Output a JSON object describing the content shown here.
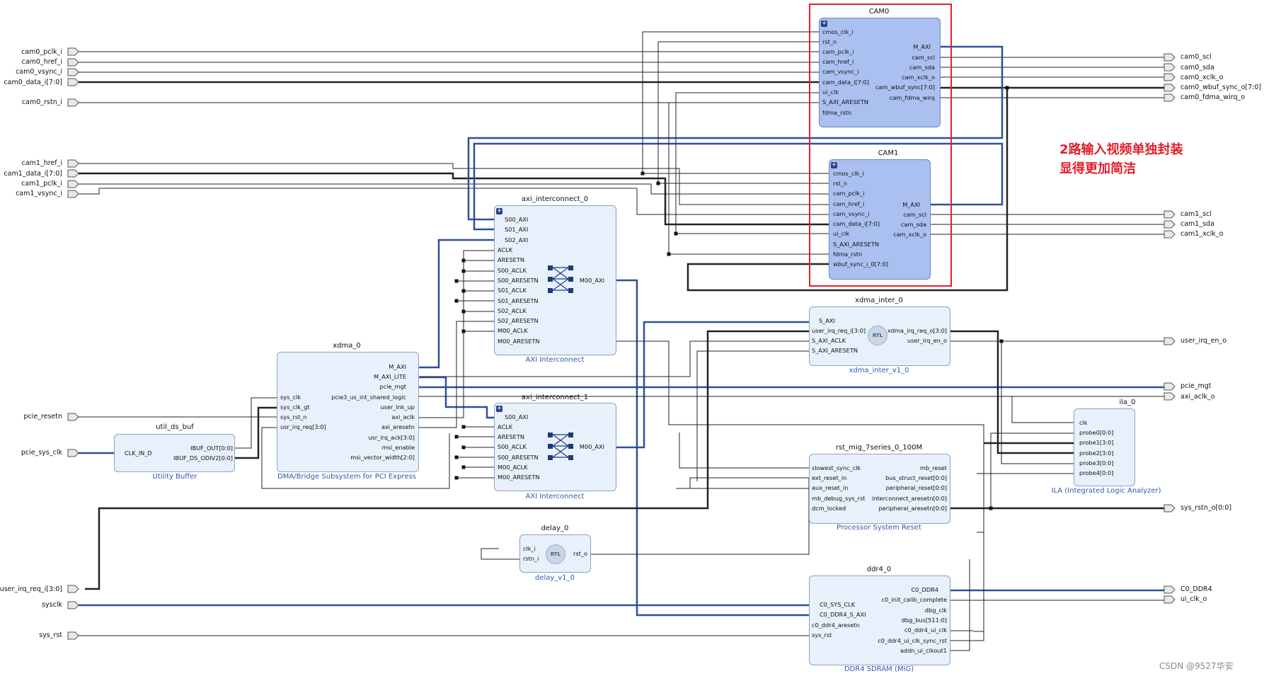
{
  "external_ports": {
    "left": {
      "cam0_pclk_i": "cam0_pclk_i",
      "cam0_href_i": "cam0_href_i",
      "cam0_vsync_i": "cam0_vsync_i",
      "cam0_data_i": "cam0_data_i[7:0]",
      "cam0_rstn_i": "cam0_rstn_i",
      "cam1_href_i": "cam1_href_i",
      "cam1_data_i": "cam1_data_i[7:0]",
      "cam1_pclk_i": "cam1_pclk_i",
      "cam1_vsync_i": "cam1_vsync_i",
      "pcie_resetn": "pcie_resetn",
      "pcie_sys_clk": "pcie_sys_clk",
      "user_irq_req_i": "user_irq_req_i[3:0]",
      "sysclk": "sysclk",
      "sys_rst": "sys_rst"
    },
    "right": {
      "cam0_scl": "cam0_scl",
      "cam0_sda": "cam0_sda",
      "cam0_xclk_o": "cam0_xclk_o",
      "cam0_wbuf_sync_o": "cam0_wbuf_sync_o[7:0]",
      "cam0_fdma_wirq_o": "cam0_fdma_wirq_o",
      "cam1_scl": "cam1_scl",
      "cam1_sda": "cam1_sda",
      "cam1_xclk_o": "cam1_xclk_o",
      "user_irq_en_o": "user_irq_en_o",
      "pcie_mgt": "pcie_mgt",
      "axi_aclk_o": "axi_aclk_o",
      "sys_rstn_o": "sys_rstn_o[0:0]",
      "C0_DDR4": "C0_DDR4",
      "ui_clk_o": "ui_clk_o"
    }
  },
  "blocks": {
    "cam0": {
      "title": "CAM0",
      "left_pins": [
        "cmos_clk_i",
        "rst_n",
        "cam_pclk_i",
        "cam_href_i",
        "cam_vsync_i",
        "cam_data_i[7:0]",
        "ui_clk",
        "S_AXI_ARESETN",
        "fdma_rstn"
      ],
      "right_pins": [
        "M_AXI",
        "cam_scl",
        "cam_sda",
        "cam_xclk_o",
        "cam_wbuf_sync[7:0]",
        "cam_fdma_wirq"
      ]
    },
    "cam1": {
      "title": "CAM1",
      "left_pins": [
        "cmos_clk_i",
        "rst_n",
        "cam_pclk_i",
        "cam_href_i",
        "cam_vsync_i",
        "cam_data_i[7:0]",
        "ui_clk",
        "S_AXI_ARESETN",
        "fdma_rstn",
        "wbuf_sync_i_0[7:0]"
      ],
      "right_pins": [
        "M_AXI",
        "cam_scl",
        "cam_sda",
        "cam_xclk_o"
      ]
    },
    "axi_ic0": {
      "title": "axi_interconnect_0",
      "subtitle": "AXI Interconnect",
      "left_pins": [
        "S00_AXI",
        "S01_AXI",
        "S02_AXI",
        "ACLK",
        "ARESETN",
        "S00_ACLK",
        "S00_ARESETN",
        "S01_ACLK",
        "S01_ARESETN",
        "S02_ACLK",
        "S02_ARESETN",
        "M00_ACLK",
        "M00_ARESETN"
      ],
      "right_pins": [
        "M00_AXI"
      ]
    },
    "axi_ic1": {
      "title": "axi_interconnect_1",
      "subtitle": "AXI Interconnect",
      "left_pins": [
        "S00_AXI",
        "ACLK",
        "ARESETN",
        "S00_ACLK",
        "S00_ARESETN",
        "M00_ACLK",
        "M00_ARESETN"
      ],
      "right_pins": [
        "M00_AXI"
      ]
    },
    "xdma": {
      "title": "xdma_0",
      "subtitle": "DMA/Bridge Subsystem for PCI Express",
      "left_pins": [
        "sys_clk",
        "sys_clk_gt",
        "sys_rst_n",
        "usr_irq_req[3:0]"
      ],
      "right_pins": [
        "M_AXI",
        "M_AXI_LITE",
        "pcie_mgt",
        "pcie3_us_int_shared_logic",
        "user_lnk_up",
        "axi_aclk",
        "axi_aresetn",
        "usr_irq_ack[3:0]",
        "msi_enable",
        "msi_vector_width[2:0]"
      ]
    },
    "util": {
      "title": "util_ds_buf",
      "subtitle": "Utility Buffer",
      "left_pins": [
        "CLK_IN_D"
      ],
      "right_pins": [
        "IBUF_OUT[0:0]",
        "IBUF_DS_ODIV2[0:0]"
      ]
    },
    "xdma_inter": {
      "title": "xdma_inter_0",
      "subtitle": "xdma_inter_v1_0",
      "left_pins": [
        "S_AXI",
        "user_irq_req_i[3:0]",
        "S_AXI_ACLK",
        "S_AXI_ARESETN"
      ],
      "right_pins": [
        "xdma_irq_req_o[3:0]",
        "user_irq_en_o"
      ],
      "badge": "RTL"
    },
    "rst": {
      "title": "rst_mig_7series_0_100M",
      "subtitle": "Processor System Reset",
      "left_pins": [
        "slowest_sync_clk",
        "ext_reset_in",
        "aux_reset_in",
        "mb_debug_sys_rst",
        "dcm_locked"
      ],
      "right_pins": [
        "mb_reset",
        "bus_struct_reset[0:0]",
        "peripheral_reset[0:0]",
        "interconnect_aresetn[0:0]",
        "peripheral_aresetn[0:0]"
      ]
    },
    "ila": {
      "title": "ila_0",
      "subtitle": "ILA (Integrated Logic Analyzer)",
      "left_pins": [
        "clk",
        "probe0[0:0]",
        "probe1[3:0]",
        "probe2[3:0]",
        "probe3[0:0]",
        "probe4[0:0]"
      ]
    },
    "delay": {
      "title": "delay_0",
      "subtitle": "delay_v1_0",
      "left_pins": [
        "clk_i",
        "rstn_i"
      ],
      "right_pins": [
        "rst_o"
      ],
      "badge": "RTL"
    },
    "ddr4": {
      "title": "ddr4_0",
      "subtitle": "DDR4 SDRAM (MIG)",
      "left_pins": [
        "C0_SYS_CLK",
        "C0_DDR4_S_AXI",
        "c0_ddr4_aresetn",
        "sys_rst"
      ],
      "right_pins": [
        "C0_DDR4",
        "c0_init_calib_complete",
        "dbg_clk",
        "dbg_bus[511:0]",
        "c0_ddr4_ui_clk",
        "c0_ddr4_ui_clk_sync_rst",
        "addn_ui_clkout1"
      ]
    }
  },
  "annotation": {
    "line1": "2路输入视频单独封装",
    "line2": "显得更加简洁"
  },
  "watermark": "CSDN @9527华安",
  "colors": {
    "wire": "#222222",
    "bus": "#2f4f9a",
    "highlight_block": "#aac0f0",
    "block": "#e8f0fb",
    "annotation": "#e0202a"
  }
}
